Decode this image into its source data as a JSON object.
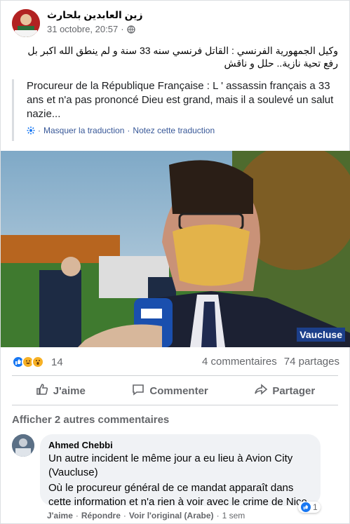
{
  "post": {
    "author": "زين العابدين بلحارث",
    "date": "31 octobre, 20:57",
    "dot": "·",
    "text": "وكيل الجمهورية الفرنسي : القاتل فرنسي سنه 33 سنة و لم ينطق الله اكبر بل رفع تحية نازية.. حلل و ناقش",
    "translation": "Procureur de la République Française : L ' assassin français a 33 ans et n'a pas prononcé Dieu est grand, mais il a soulevé un salut nazie...",
    "hide_translation": "Masquer la traduction",
    "rate_translation": "Notez cette traduction",
    "video_watermark": "Vaucluse",
    "reactions_count": "14",
    "comments_count": "4 commentaires",
    "shares_count": "74 partages"
  },
  "actions": {
    "like": "J'aime",
    "comment": "Commenter",
    "share": "Partager"
  },
  "comments": {
    "more": "Afficher 2 autres commentaires",
    "item": {
      "author": "Ahmed Chebbi",
      "text1": "Un autre incident le même jour a eu lieu à Avion City (Vaucluse)",
      "text2": "Où le procureur général de ce mandat apparaît dans cette information et n'a rien à voir avec le crime de Nice.",
      "reaction_count": "1",
      "like": "J'aime",
      "reply": "Répondre",
      "see_original": "Voir l'original (Arabe)",
      "time": "1 sem"
    }
  },
  "colors": {
    "link": "#385898",
    "meta": "#65676b",
    "like_blue": "#1877f2"
  }
}
